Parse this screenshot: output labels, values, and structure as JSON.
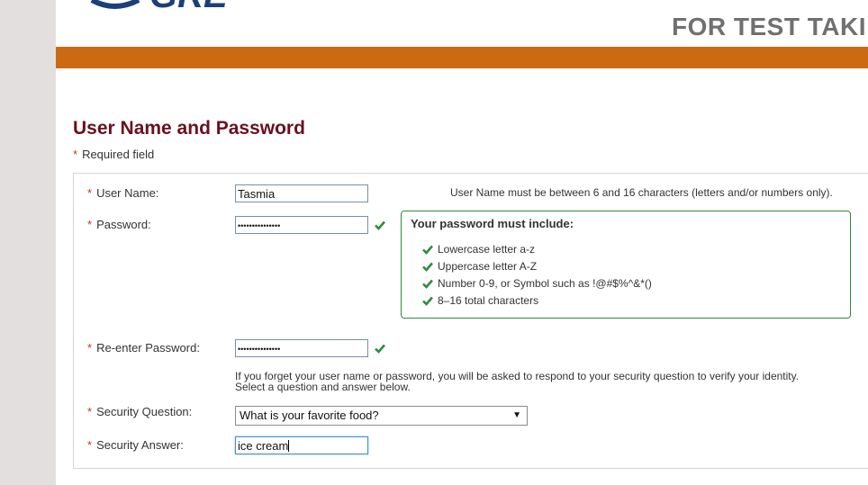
{
  "header": {
    "title": "FOR TEST TAKI",
    "logo_text": "GRE"
  },
  "form": {
    "section_title": "User Name and Password",
    "required_note": "Required field",
    "required_marker": "*",
    "username": {
      "label": "User Name:",
      "value": "Tasmia",
      "hint": "User Name must be between 6 and 16 characters (letters and/or numbers only)."
    },
    "password": {
      "label": "Password:",
      "value": "•••••••••••••••",
      "requirements_title": "Your password must include:",
      "requirements": [
        "Lowercase letter a-z",
        "Uppercase letter A-Z",
        "Number 0-9, or Symbol such as !@#$%^&*()",
        "8–16 total characters"
      ]
    },
    "reenter_password": {
      "label": "Re-enter Password:",
      "value": "•••••••••••••••"
    },
    "security_note": {
      "line1": "If you forget your user name or password, you will be asked to respond to your security question to verify your identity.",
      "line2": "Select a question and answer below."
    },
    "security_question": {
      "label": "Security Question:",
      "selected": "What is your favorite food?"
    },
    "security_answer": {
      "label": "Security Answer:",
      "value": "ice cream"
    }
  },
  "colors": {
    "accent_bar": "#cc6a14",
    "title": "#6b1020",
    "check": "#2e8b3c",
    "logo": "#1b3f7a"
  }
}
